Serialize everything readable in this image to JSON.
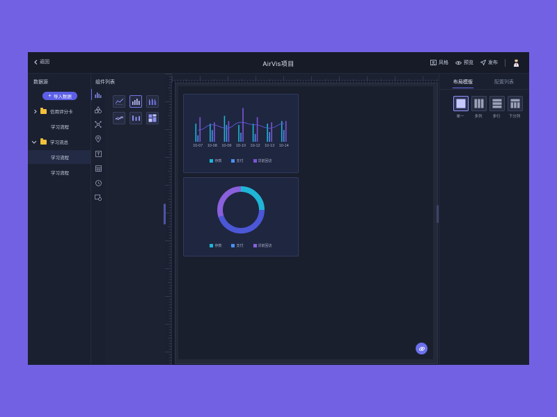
{
  "topbar": {
    "back_label": "返回",
    "title": "AirVis项目",
    "actions": [
      {
        "label": "风格",
        "icon": "portrait-icon"
      },
      {
        "label": "预览",
        "icon": "eye-icon"
      },
      {
        "label": "发布",
        "icon": "send-icon"
      }
    ]
  },
  "left_panel": {
    "title": "数据源",
    "import_button": "导入数据",
    "tree": [
      {
        "label": "信用评分卡",
        "type": "folder",
        "expanded": false
      },
      {
        "label": "学习流程",
        "type": "item"
      },
      {
        "label": "学习流总",
        "type": "folder",
        "expanded": true
      },
      {
        "label": "学习流程",
        "type": "item",
        "selected": true
      },
      {
        "label": "学习流程",
        "type": "item"
      }
    ]
  },
  "icon_rail": [
    "bar-chart-icon",
    "shapes-icon",
    "network-icon",
    "location-icon",
    "text-box-icon",
    "table-icon",
    "clock-icon",
    "media-icon"
  ],
  "components": {
    "title": "组件列表",
    "thumbnails": [
      "line-chart-thumb",
      "bar-chart-thumb",
      "grouped-bar-thumb",
      "multi-line-thumb",
      "capsule-bar-thumb",
      "grid-thumb"
    ]
  },
  "chart_data": [
    {
      "type": "bar",
      "categories": [
        "10-07",
        "10-08",
        "10-09",
        "10-10",
        "10-12",
        "10-13",
        "10-14"
      ],
      "series": [
        {
          "name": "存款",
          "values": [
            28,
            28,
            40,
            26,
            28,
            28,
            32
          ]
        },
        {
          "name": "支付",
          "values": [
            10,
            18,
            26,
            14,
            12,
            15,
            18
          ]
        },
        {
          "name": "贷前回访",
          "values": [
            38,
            30,
            32,
            52,
            38,
            30,
            32
          ]
        }
      ],
      "line": {
        "values": [
          18,
          26,
          21,
          30,
          26,
          21,
          28
        ]
      },
      "colors": [
        "#1fb5d6",
        "#4a8ff0",
        "#7c55d8"
      ]
    },
    {
      "type": "pie",
      "donut": true,
      "labels": [
        "存款",
        "支付",
        "贷前回访"
      ],
      "values": [
        25,
        45,
        30
      ],
      "colors": [
        "#1fb5d6",
        "#4b57d6",
        "#8a60dc"
      ]
    }
  ],
  "right_panel": {
    "tabs": [
      "布局模版",
      "配置列表"
    ],
    "layouts": [
      "单一",
      "多列",
      "多行",
      "下分列"
    ]
  }
}
